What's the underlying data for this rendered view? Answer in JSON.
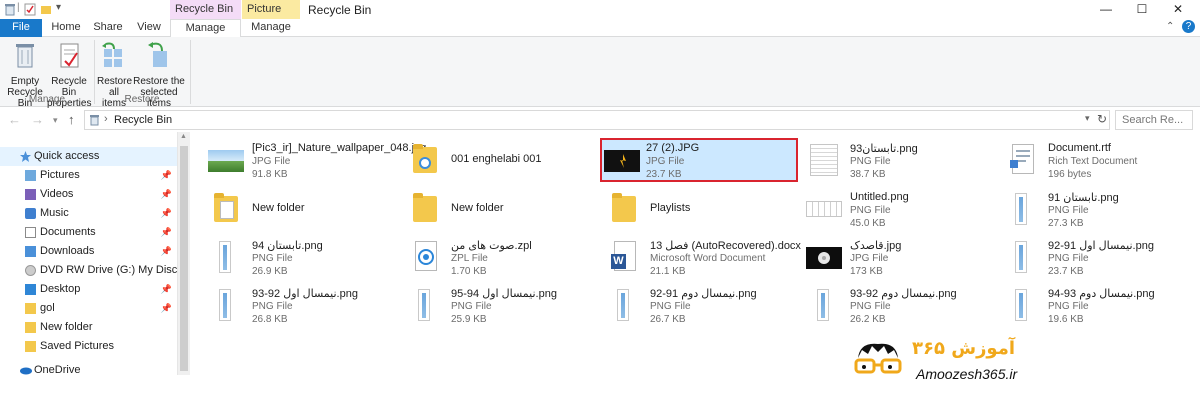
{
  "window": {
    "title": "Recycle Bin",
    "context_tabs": [
      "Recycle Bin Tools",
      "Picture Tools"
    ],
    "controls": {
      "minimize": "—",
      "maximize": "☐",
      "close": "✕"
    }
  },
  "ribbon": {
    "tabs": {
      "file": "File",
      "home": "Home",
      "share": "Share",
      "view": "View",
      "manage1": "Manage",
      "manage2": "Manage"
    },
    "buttons": {
      "empty_l1": "Empty",
      "empty_l2": "Recycle Bin",
      "props_l1": "Recycle Bin",
      "props_l2": "properties",
      "restore_all_l1": "Restore",
      "restore_all_l2": "all items",
      "restore_sel_l1": "Restore the",
      "restore_sel_l2": "selected items"
    },
    "groups": {
      "manage": "Manage",
      "restore": "Restore"
    }
  },
  "address": {
    "location": "Recycle Bin",
    "search_placeholder": "Search Re..."
  },
  "nav": {
    "quick_access": "Quick access",
    "items": [
      "Pictures",
      "Videos",
      "Music",
      "Documents",
      "Downloads",
      "DVD RW Drive (G:) My Disc",
      "Desktop",
      "gol",
      "New folder",
      "Saved Pictures"
    ],
    "onedrive": "OneDrive"
  },
  "files": [
    {
      "name": "[Pic3_ir]_Nature_wallpaper_048.jpg",
      "type": "JPG File",
      "size": "91.8 KB"
    },
    {
      "name": "001 enghelabi 001",
      "type": "",
      "size": ""
    },
    {
      "name": "27 (2).JPG",
      "type": "JPG File",
      "size": "23.7 KB"
    },
    {
      "name": "تابستان93.png",
      "type": "PNG File",
      "size": "38.7 KB"
    },
    {
      "name": "Document.rtf",
      "type": "Rich Text Document",
      "size": "196 bytes"
    },
    {
      "name": "New folder",
      "type": "",
      "size": ""
    },
    {
      "name": "New folder",
      "type": "",
      "size": ""
    },
    {
      "name": "Playlists",
      "type": "",
      "size": ""
    },
    {
      "name": "Untitled.png",
      "type": "PNG File",
      "size": "45.0 KB"
    },
    {
      "name": "تابستان 91.png",
      "type": "PNG File",
      "size": "27.3 KB"
    },
    {
      "name": "تابستان 94.png",
      "type": "PNG File",
      "size": "26.9 KB"
    },
    {
      "name": "صوت های من.zpl",
      "type": "ZPL File",
      "size": "1.70 KB"
    },
    {
      "name": "فصل 13 (AutoRecovered).docx",
      "type": "Microsoft Word Document",
      "size": "21.1 KB"
    },
    {
      "name": "قاصدک.jpg",
      "type": "JPG File",
      "size": "173 KB"
    },
    {
      "name": "نیمسال اول 91-92.png",
      "type": "PNG File",
      "size": "23.7 KB"
    },
    {
      "name": "نیمسال اول 92-93.png",
      "type": "PNG File",
      "size": "26.8 KB"
    },
    {
      "name": "نیمسال اول 94-95.png",
      "type": "PNG File",
      "size": "25.9 KB"
    },
    {
      "name": "نیمسال دوم 91-92.png",
      "type": "PNG File",
      "size": "26.7 KB"
    },
    {
      "name": "نیمسال دوم 92-93.png",
      "type": "PNG File",
      "size": "26.2 KB"
    },
    {
      "name": "نیمسال دوم 93-94.png",
      "type": "PNG File",
      "size": "19.6 KB"
    }
  ],
  "watermark": {
    "brand": "Amoozesh365.ir",
    "logo_text": "آموزش ۳۶۵"
  },
  "colors": {
    "file_tab": "#1979ca",
    "selection_bg": "#cce8ff",
    "selection_border": "#d9242f",
    "recycle_ctx": "#f4dcf7",
    "picture_ctx": "#fbeaa1"
  }
}
